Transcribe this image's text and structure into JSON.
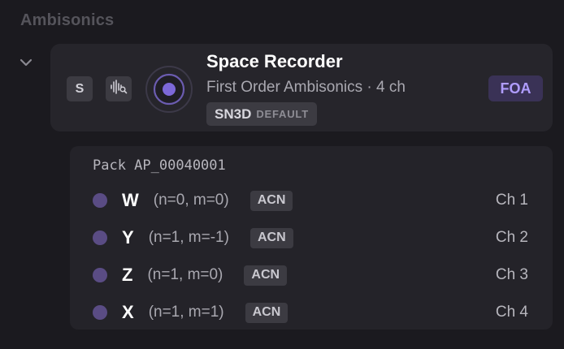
{
  "section": {
    "title": "Ambisonics"
  },
  "device": {
    "solo_label": "S",
    "name": "Space Recorder",
    "subtitle": "First Order Ambisonics · 4 ch",
    "normalization": "SN3D",
    "normalization_tag": "DEFAULT",
    "format_badge": "FOA"
  },
  "pack": {
    "title": "Pack AP_00040001",
    "channels": [
      {
        "letter": "W",
        "indices": "(n=0, m=0)",
        "ordering": "ACN",
        "channel": "Ch 1"
      },
      {
        "letter": "Y",
        "indices": "(n=1, m=-1)",
        "ordering": "ACN",
        "channel": "Ch 2"
      },
      {
        "letter": "Z",
        "indices": "(n=1, m=0)",
        "ordering": "ACN",
        "channel": "Ch 3"
      },
      {
        "letter": "X",
        "indices": "(n=1, m=1)",
        "ordering": "ACN",
        "channel": "Ch 4"
      }
    ]
  },
  "icons": {
    "collapse": "chevron-down-icon",
    "waveform": "waveform-search-icon",
    "device": "ambisonic-target-icon"
  },
  "colors": {
    "background": "#1b1a1f",
    "accent": "#b09dff",
    "channel_dot": "#5a4c84"
  }
}
